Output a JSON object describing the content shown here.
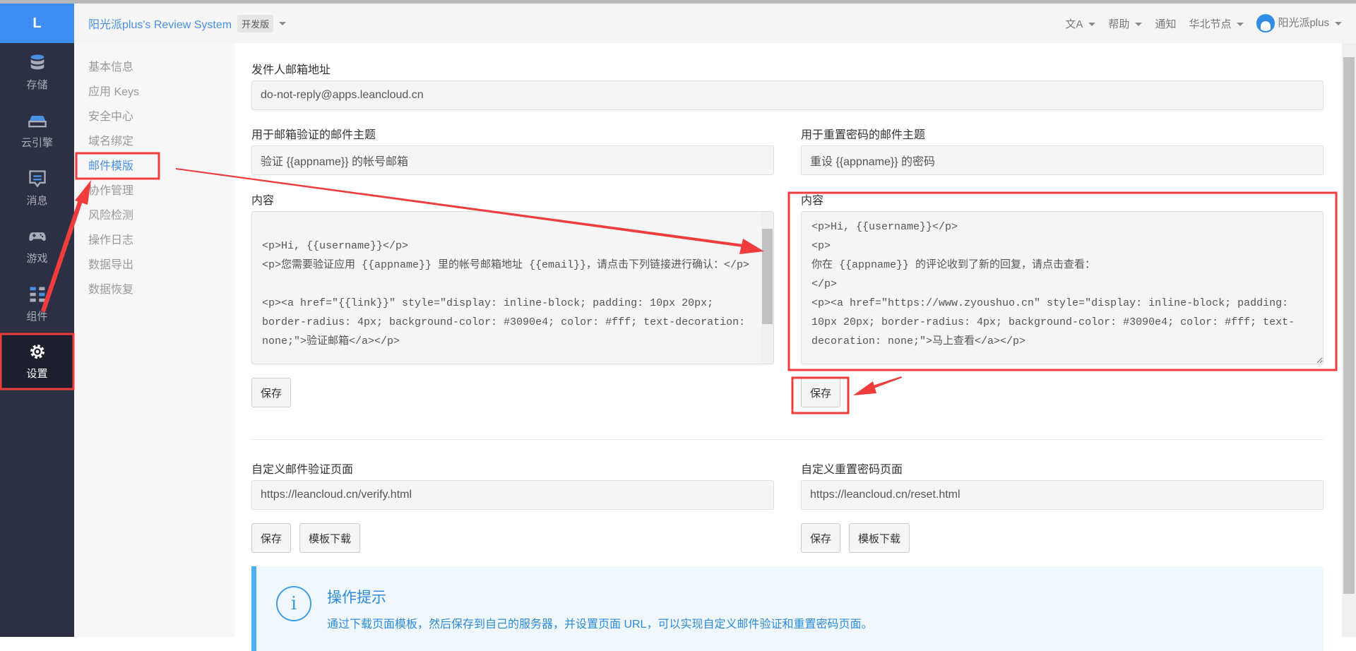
{
  "logo": "L",
  "sidebar": {
    "items": [
      {
        "label": "存储",
        "icon": "database-icon"
      },
      {
        "label": "云引擎",
        "icon": "server-icon"
      },
      {
        "label": "消息",
        "icon": "message-icon"
      },
      {
        "label": "游戏",
        "icon": "gamepad-icon"
      },
      {
        "label": "组件",
        "icon": "components-icon"
      },
      {
        "label": "设置",
        "icon": "gear-icon",
        "active": true
      }
    ]
  },
  "header": {
    "app_title": "阳光派plus's Review System",
    "badge": "开发版",
    "translate": "文A",
    "help": "帮助",
    "notify": "通知",
    "region": "华北节点",
    "user": "阳光派plus"
  },
  "subnav": {
    "items": [
      "基本信息",
      "应用 Keys",
      "安全中心",
      "域名绑定",
      "邮件模版",
      "协作管理",
      "风险检测",
      "操作日志",
      "数据导出",
      "数据恢复"
    ],
    "active": "邮件模版"
  },
  "form": {
    "sender_label": "发件人邮箱地址",
    "sender_value": "do-not-reply@apps.leancloud.cn",
    "verify_subject_label": "用于邮箱验证的邮件主题",
    "verify_subject_value": "验证 {{appname}} 的帐号邮箱",
    "reset_subject_label": "用于重置密码的邮件主题",
    "reset_subject_value": "重设 {{appname}} 的密码",
    "content_label": "内容",
    "verify_content": "\n<p>Hi, {{username}}</p>\n<p>您需要验证应用 {{appname}} 里的帐号邮箱地址 {{email}}，请点击下列链接进行确认：</p>\n\n<p><a href=\"{{link}}\" style=\"display: inline-block; padding: 10px 20px; border-radius: 4px; background-color: #3090e4; color: #fff; text-decoration: none;\">验证邮箱</a></p>",
    "reset_content": "<p>Hi, {{username}}</p>\n<p>\n你在 {{appname}} 的评论收到了新的回复，请点击查看：\n</p>\n<p><a href=\"https://www.zyoushuo.cn\" style=\"display: inline-block; padding: 10px 20px; border-radius: 4px; background-color: #3090e4; color: #fff; text-decoration: none;\">马上查看</a></p>",
    "save": "保存",
    "verify_page_label": "自定义邮件验证页面",
    "verify_page_value": "https://leancloud.cn/verify.html",
    "reset_page_label": "自定义重置密码页面",
    "reset_page_value": "https://leancloud.cn/reset.html",
    "download": "模板下载"
  },
  "tip": {
    "title": "操作提示",
    "text": "通过下载页面模板，然后保存到自己的服务器，并设置页面 URL，可以实现自定义邮件验证和重置密码页面。"
  },
  "colors": {
    "accent": "#4a90e2",
    "annotation": "#f03c3c",
    "sidebar": "#2d3045"
  }
}
